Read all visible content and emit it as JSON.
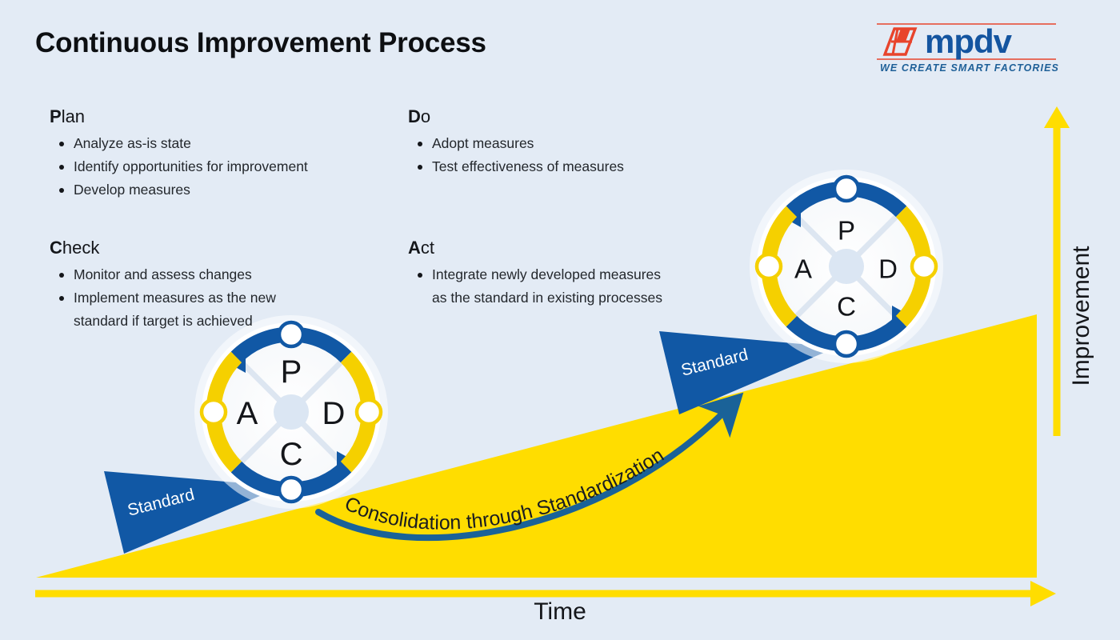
{
  "page": {
    "title": "Continuous Improvement Process",
    "background_color": "#e3ebf5"
  },
  "logo": {
    "name": "mpdv",
    "wordmark": "mpdv",
    "tagline": "WE CREATE SMART FACTORIES",
    "mark_color": "#e8442c",
    "word_color": "#1455a0",
    "tagline_color": "#1f6098"
  },
  "colors": {
    "blue": "#1158a5",
    "blue_dark": "#0f5496",
    "yellow": "#ffdd00",
    "yellow_arc": "#f5d000",
    "background": "#e3ebf5",
    "text": "#14161a",
    "white": "#ffffff"
  },
  "sections": [
    {
      "id": "plan",
      "initial": "P",
      "rest": "lan",
      "items": [
        "Analyze as-is state",
        "Identify opportunities for improvement",
        "Develop measures"
      ]
    },
    {
      "id": "do",
      "initial": "D",
      "rest": "o",
      "items": [
        "Adopt measures",
        "Test effectiveness of measures"
      ]
    },
    {
      "id": "check",
      "initial": "C",
      "rest": "heck",
      "items": [
        "Monitor and assess changes",
        "Implement measures as the new\nstandard if target is achieved"
      ]
    },
    {
      "id": "act",
      "initial": "A",
      "rest": "ct",
      "items": [
        "Integrate newly developed measures\nas the standard in existing processes"
      ]
    }
  ],
  "wheels": [
    {
      "id": "lower-wheel",
      "letters": {
        "top": "P",
        "right": "D",
        "bottom": "C",
        "left": "A"
      }
    },
    {
      "id": "upper-wheel",
      "letters": {
        "top": "P",
        "right": "D",
        "bottom": "C",
        "left": "A"
      }
    }
  ],
  "banners": [
    {
      "id": "lower-standard",
      "label": "Standard"
    },
    {
      "id": "upper-standard",
      "label": "Standard"
    }
  ],
  "curved_arrow": {
    "label": "Consolidation through Standardization"
  },
  "axes": {
    "x_label": "Time",
    "y_label": "Improvement",
    "x_arrow_color": "#ffdd00",
    "y_arrow_color": "#ffdd00"
  },
  "chart_data": {
    "type": "area",
    "title": "Continuous Improvement Process",
    "xlabel": "Time",
    "ylabel": "Improvement",
    "description": "Yellow improvement ramp rising from left to right, with two PDCA cycle wheels rolling up the slope, each blocked from rolling back by a blue 'Standard' wedge, and a curved arrow labelled 'Consolidation through Standardization'.",
    "series": [
      {
        "name": "Improvement level",
        "x": [
          0,
          100
        ],
        "values": [
          0,
          100
        ]
      }
    ],
    "annotations": [
      {
        "label": "Standard",
        "x": 10,
        "y": 8
      },
      {
        "label": "Standard",
        "x": 64,
        "y": 58
      },
      {
        "label": "Consolidation through Standardization",
        "x": 48,
        "y": 30
      }
    ],
    "grid": false,
    "legend": "none"
  }
}
